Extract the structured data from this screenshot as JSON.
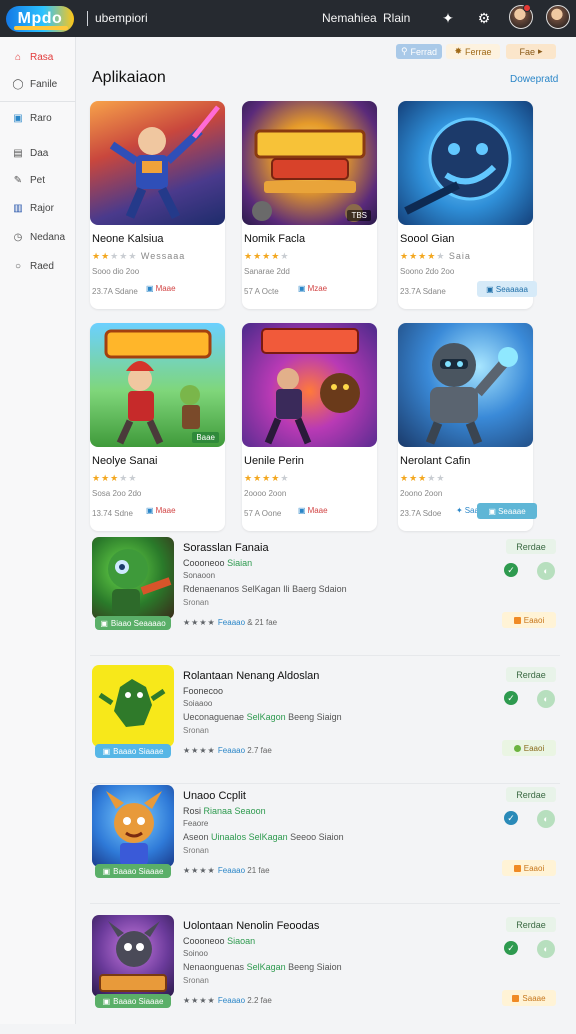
{
  "header": {
    "logo": "Mpdo",
    "breadcrumb": "ubempiori",
    "links": [
      "Nemahiea",
      "Rlain"
    ],
    "icons": [
      "puzzle-icon",
      "settings-icon"
    ]
  },
  "sidebar": {
    "items": [
      {
        "label": "Rasa",
        "icon": "home-icon",
        "active": true
      },
      {
        "label": "Fanile",
        "icon": "bell-icon",
        "active": false
      },
      {
        "label": "Raro",
        "icon": "window-icon",
        "active": false
      },
      {
        "label": "Daa",
        "icon": "calendar-icon",
        "active": false
      },
      {
        "label": "Pet",
        "icon": "edit-icon",
        "active": false
      },
      {
        "label": "Rajor",
        "icon": "book-icon",
        "active": false
      },
      {
        "label": "Nedana",
        "icon": "clock-icon",
        "active": false
      },
      {
        "label": "Raed",
        "icon": "circle-icon",
        "active": false
      }
    ]
  },
  "filters": [
    {
      "label": "Ferrad",
      "icon": "filter-icon"
    },
    {
      "label": "Ferrae",
      "icon": "sparkle-icon"
    },
    {
      "label": "Fae",
      "icon": "chevron-icon"
    }
  ],
  "page_title": "Aplikaiaon",
  "see_all": "Dowepratd",
  "cards": [
    {
      "name": "Neone Kalsiua",
      "rating": 2,
      "stars_text": "Wessaaa",
      "meta": "Sooo dio 2oo",
      "foot": "23.7A Sdane",
      "tag": "Maae",
      "badge": "",
      "button": ""
    },
    {
      "name": "Nomik Facla",
      "rating": 4,
      "stars_text": "",
      "meta": "Sanarae 2dd",
      "foot": "57 A Octe",
      "tag": "Mzae",
      "badge": "TBS",
      "button": ""
    },
    {
      "name": "Soool Gian",
      "rating": 4,
      "stars_text": "Saia",
      "meta": "Soono 2do 2oo",
      "foot": "23.7A Sdane",
      "tag": "",
      "badge": "",
      "button": "Seaaaaa"
    },
    {
      "name": "Neolye Sanai",
      "rating": 3,
      "stars_text": "",
      "meta": "Sosa 2oo 2do",
      "foot": "13.74 Sdne",
      "tag": "Maae",
      "badge": "Baae",
      "button": ""
    },
    {
      "name": "Uenile Perin",
      "rating": 4,
      "stars_text": "",
      "meta": "2oooo 2oon",
      "foot": "57 A Oone",
      "tag": "Maae",
      "badge": "",
      "button": ""
    },
    {
      "name": "Nerolant Cafin",
      "rating": 3,
      "stars_text": "",
      "meta": "2oono 2oon",
      "foot": "23.7A Sdoe",
      "tag": "Saagal",
      "badge": "",
      "button": "Seaaae"
    }
  ],
  "rows": [
    {
      "title": "Sorasslan Fanaia",
      "l1a": "Coooneoo",
      "l1b": "Siaian",
      "l2": "Sonaoon",
      "l3a": "Rdenaenanos",
      "l3b": "SelKagan",
      "l3c": "Ili Baerg Sdaion",
      "l4": "Sronan",
      "stars": "★★★★",
      "rate_b": "Feaaao",
      "rate_c": "& 21 fae",
      "status": "Rerdae",
      "pill": "Biaao Seaaaao",
      "pill_color": "#5aaf68",
      "action": "Eaaoi",
      "chk": "✓",
      "chk_blue": false,
      "act_green": false
    },
    {
      "title": "Rolantaan Nenang Aldoslan",
      "l1a": "Foonecoo",
      "l1b": "",
      "l2": "Soiaaoo",
      "l3a": "Ueconaguenae",
      "l3b": "SelKagon",
      "l3c": "Beeng Siaign",
      "l4": "Sronan",
      "stars": "★★★★",
      "rate_b": "Feaaao",
      "rate_c": "2.7 fae",
      "status": "Rerdae",
      "pill": "Baaao Siaaae",
      "pill_color": "#56b6e6",
      "action": "Eaaoi",
      "chk": "✓",
      "chk_blue": false,
      "act_green": true
    },
    {
      "title": "Unaoo Ccplit",
      "l1a": "Rosi",
      "l1b": "Rianaa Seaoon",
      "l2": "Feaore",
      "l3a": "Aseon",
      "l3b": "Uinaalos SelKagan",
      "l3c": "Seeoo Siaion",
      "l4": "Sronan",
      "stars": "★★★★",
      "rate_b": "Feaaao",
      "rate_c": "21 fae",
      "status": "Rerdae",
      "pill": "Baaao Siaaae",
      "pill_color": "#5aaf68",
      "action": "Eaaoi",
      "chk": "✓",
      "chk_blue": true,
      "act_green": false
    },
    {
      "title": "Uolontaan Nenolin Feoodas",
      "l1a": "Coooneoo",
      "l1b": "Siaoan",
      "l2": "Soinoo",
      "l3a": "Nenaonguenas",
      "l3b": "SelKagan",
      "l3c": "Beeng Siaion",
      "l4": "Sronan",
      "stars": "★★★★",
      "rate_b": "Feaaao",
      "rate_c": "2.2 fae",
      "status": "Rerdae",
      "pill": "Baaao Siaaae",
      "pill_color": "#5aaf68",
      "action": "Saaae",
      "chk": "✓",
      "chk_blue": false,
      "act_green": false
    }
  ]
}
